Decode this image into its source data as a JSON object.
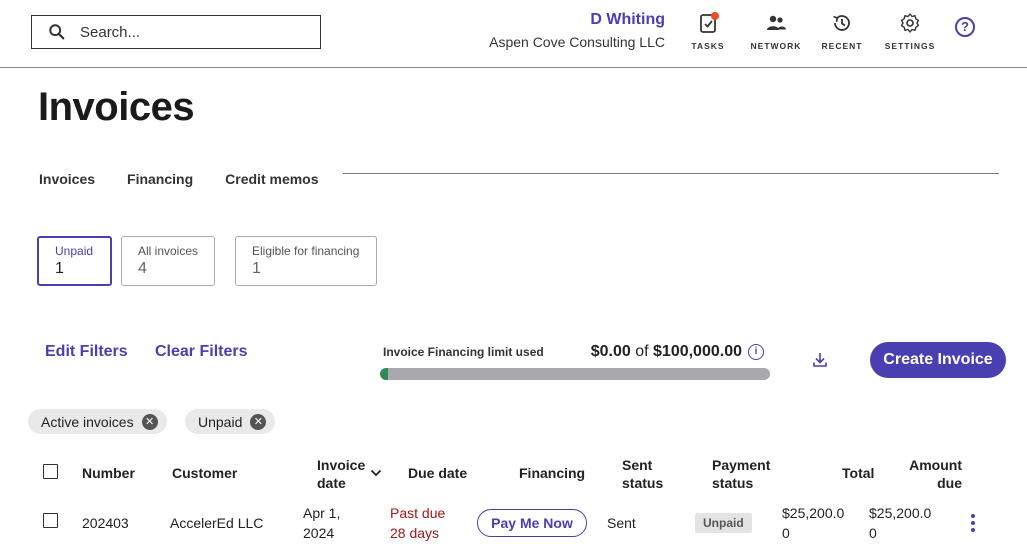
{
  "search": {
    "placeholder": "Search..."
  },
  "user": {
    "name": "D Whiting",
    "org": "Aspen Cove Consulting LLC"
  },
  "nav": [
    {
      "label": "TASKS",
      "icon": "tasks-icon"
    },
    {
      "label": "NETWORK",
      "icon": "network-icon"
    },
    {
      "label": "RECENT",
      "icon": "history-icon"
    },
    {
      "label": "SETTINGS",
      "icon": "gear-icon"
    }
  ],
  "help": {
    "glyph": "?"
  },
  "page": {
    "title": "Invoices"
  },
  "tabs": [
    "Invoices",
    "Financing",
    "Credit memos"
  ],
  "cards": [
    {
      "label": "Unpaid",
      "count": "1"
    },
    {
      "label": "All invoices",
      "count": "4"
    },
    {
      "label": "Eligible for financing",
      "count": "1"
    }
  ],
  "filters": {
    "edit": "Edit Filters",
    "clear": "Clear Filters"
  },
  "financing_limit": {
    "label": "Invoice Financing limit used",
    "used": "$0.00",
    "of": "of",
    "limit": "$100,000.00",
    "fraction_used": 0.0
  },
  "actions": {
    "create": "Create Invoice"
  },
  "chips": [
    "Active invoices",
    "Unpaid"
  ],
  "table": {
    "headers": {
      "number": "Number",
      "customer": "Customer",
      "invoice_date": [
        "Invoice",
        "date"
      ],
      "due_date": "Due date",
      "financing": "Financing",
      "sent_status": [
        "Sent",
        "status"
      ],
      "payment_status": [
        "Payment",
        "status"
      ],
      "total": "Total",
      "amount_due": [
        "Amount",
        "due"
      ]
    },
    "rows": [
      {
        "number": "202403",
        "customer": "AccelerEd LLC",
        "invoice_date": [
          "Apr 1,",
          "2024"
        ],
        "due": [
          "Past due",
          "28 days"
        ],
        "financing": "Pay Me Now",
        "sent": "Sent",
        "payment": "Unpaid",
        "total": [
          "$25,200.0",
          "0"
        ],
        "amount_due": [
          "$25,200.0",
          "0"
        ]
      }
    ]
  },
  "colors": {
    "accent": "#4a3fb0",
    "past_due": "#a01818",
    "progress_fill": "#2e8b57",
    "notification": "#ee4b2b"
  }
}
